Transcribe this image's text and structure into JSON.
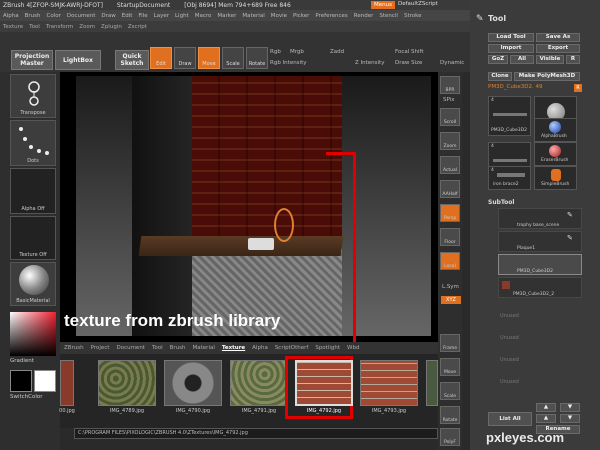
{
  "titlebar": {
    "app": "ZBrush 4[ZFOP-SMJK-AWRJ-DFOT]",
    "doc": "StartupDocument",
    "mem": "[Obj 8694]  Mem 794+689  Free 846",
    "menus": "Menus",
    "script": "DefaultZScript"
  },
  "menubar": [
    "Alpha",
    "Brush",
    "Color",
    "Document",
    "Draw",
    "Edit",
    "File",
    "Layer",
    "Light",
    "Macro",
    "Marker",
    "Material",
    "Movie",
    "Picker",
    "Preferences",
    "Render",
    "Stencil",
    "Stroke"
  ],
  "submenubar": [
    "Texture",
    "Tool",
    "Transform",
    "Zoom",
    "Zplugin",
    "Zscript"
  ],
  "toolbar": {
    "projection": "Projection Master",
    "lightbox": "LightBox",
    "quick": "Quick Sketch",
    "edit": "Edit",
    "draw": "Draw",
    "move": "Move",
    "scale": "Scale",
    "rotate": "Rotate",
    "rgb": "Rgb",
    "mrgb": "Mrgb",
    "zsub": "Zadd",
    "zintensity": "Z Intensity",
    "focal": "Focal Shift",
    "drawsize": "Draw Size",
    "dynamic": "Dynamic",
    "rgbint": "Rgb Intensity"
  },
  "leftshelf": {
    "transpose": "Transpose",
    "dots": "Dots",
    "alpha": "Alpha Off",
    "texture": "Texture Off",
    "material": "BasicMaterial",
    "gradient": "Gradient",
    "switchcolor": "SwitchColor"
  },
  "overlay": "texture from zbrush library",
  "tabstrip": {
    "items": [
      "ZBrush",
      "Project",
      "Document",
      "Tool",
      "Brush",
      "Material",
      "Texture",
      "Alpha",
      "ScriptOtherf",
      "Spotlight",
      "Wbd"
    ],
    "active": "Texture"
  },
  "thumbs": [
    "IMG_4789.jpg",
    "IMG_4790.jpg",
    "IMG_4791.jpg",
    "IMG_4792.jpg",
    "IMG_4793.jpg"
  ],
  "thumb_first_caption": "00.jpg",
  "path": "C:\\PROGRAM FILES\\PIXOLOGIC\\ZBRUSH 4.0\\ZTextures\\IMG_4792.jpg",
  "rightshelf": [
    "BPR",
    "SPix",
    "Scroll",
    "Zoom",
    "Actual",
    "AAHalf",
    "Persp",
    "Floor",
    "Local",
    "L.Sym",
    "XYZ",
    "Frame",
    "Move",
    "Scale",
    "Rotate",
    "PolyF"
  ],
  "toolpanel": {
    "title": "Tool",
    "load": "Load Tool",
    "saveas": "Save As",
    "import": "Import",
    "export": "Export",
    "goz": "GoZ",
    "all": "All",
    "visible": "Visible",
    "r": "R",
    "clone": "Clone",
    "makepoly": "Make PolyMesh3D",
    "current": "PM3D_Cube3D2. 49",
    "tiles": [
      "PM3D_Cube3D2",
      "SphereBrush",
      "AlphaBrush",
      "PM3D_Cube3D2",
      "EraserBrush",
      "iron brace2",
      "SimpleBrush"
    ],
    "count1": "4",
    "count2": "4",
    "count3": "4"
  },
  "subtool": {
    "title": "SubTool",
    "rows": [
      "trophy base_scene",
      "Plaque1",
      "PM3D_Cube3D2",
      "PM3D_Cube3D2_2"
    ],
    "unused": [
      "Unused",
      "Unused",
      "Unused",
      "Unused",
      "Unused"
    ],
    "listall": "List All",
    "rename": "Rename"
  },
  "watermark": "pxleyes.com"
}
